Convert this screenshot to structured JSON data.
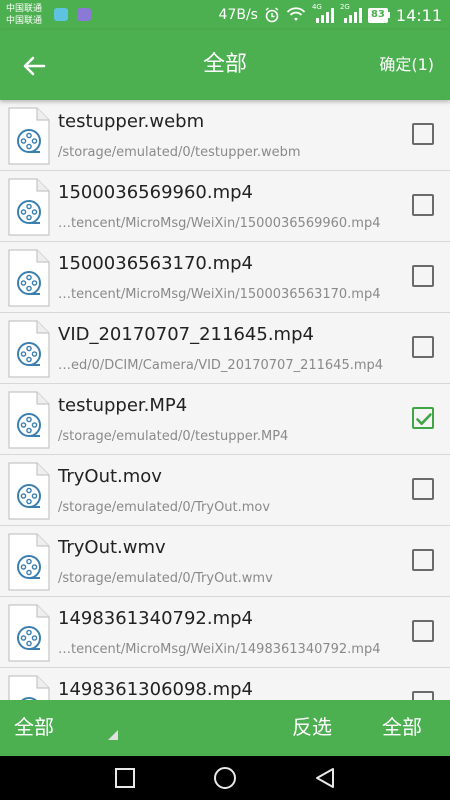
{
  "status_bar": {
    "carrier_1": "中国联通",
    "carrier_2": "中国联通",
    "net_speed": "47B/s",
    "battery": "83",
    "time": "14:11",
    "network_label": "4G",
    "network_label_2": "2G"
  },
  "app_bar": {
    "title": "全部",
    "confirm_label": "确定(1)"
  },
  "files": [
    {
      "name": "testupper.webm",
      "path": "/storage/emulated/0/testupper.webm",
      "checked": false
    },
    {
      "name": "1500036569960.mp4",
      "path": "…tencent/MicroMsg/WeiXin/1500036569960.mp4",
      "checked": false
    },
    {
      "name": "1500036563170.mp4",
      "path": "…tencent/MicroMsg/WeiXin/1500036563170.mp4",
      "checked": false
    },
    {
      "name": "VID_20170707_211645.mp4",
      "path": "…ed/0/DCIM/Camera/VID_20170707_211645.mp4",
      "checked": false
    },
    {
      "name": "testupper.MP4",
      "path": "/storage/emulated/0/testupper.MP4",
      "checked": true
    },
    {
      "name": "TryOut.mov",
      "path": "/storage/emulated/0/TryOut.mov",
      "checked": false
    },
    {
      "name": "TryOut.wmv",
      "path": "/storage/emulated/0/TryOut.wmv",
      "checked": false
    },
    {
      "name": "1498361340792.mp4",
      "path": "…tencent/MicroMsg/WeiXin/1498361340792.mp4",
      "checked": false
    },
    {
      "name": "1498361306098.mp4",
      "path": "",
      "checked": false
    }
  ],
  "bottom_bar": {
    "filter_label": "全部",
    "invert_label": "反选",
    "select_all_label": "全部"
  },
  "colors": {
    "accent": "#4caf50",
    "check": "#3fa648",
    "icon_blue": "#3b7fb0"
  },
  "icons": {
    "back": "arrow-left-icon",
    "file": "video-file-icon",
    "nav_recent": "square-icon",
    "nav_home": "circle-icon",
    "nav_back": "triangle-icon"
  }
}
